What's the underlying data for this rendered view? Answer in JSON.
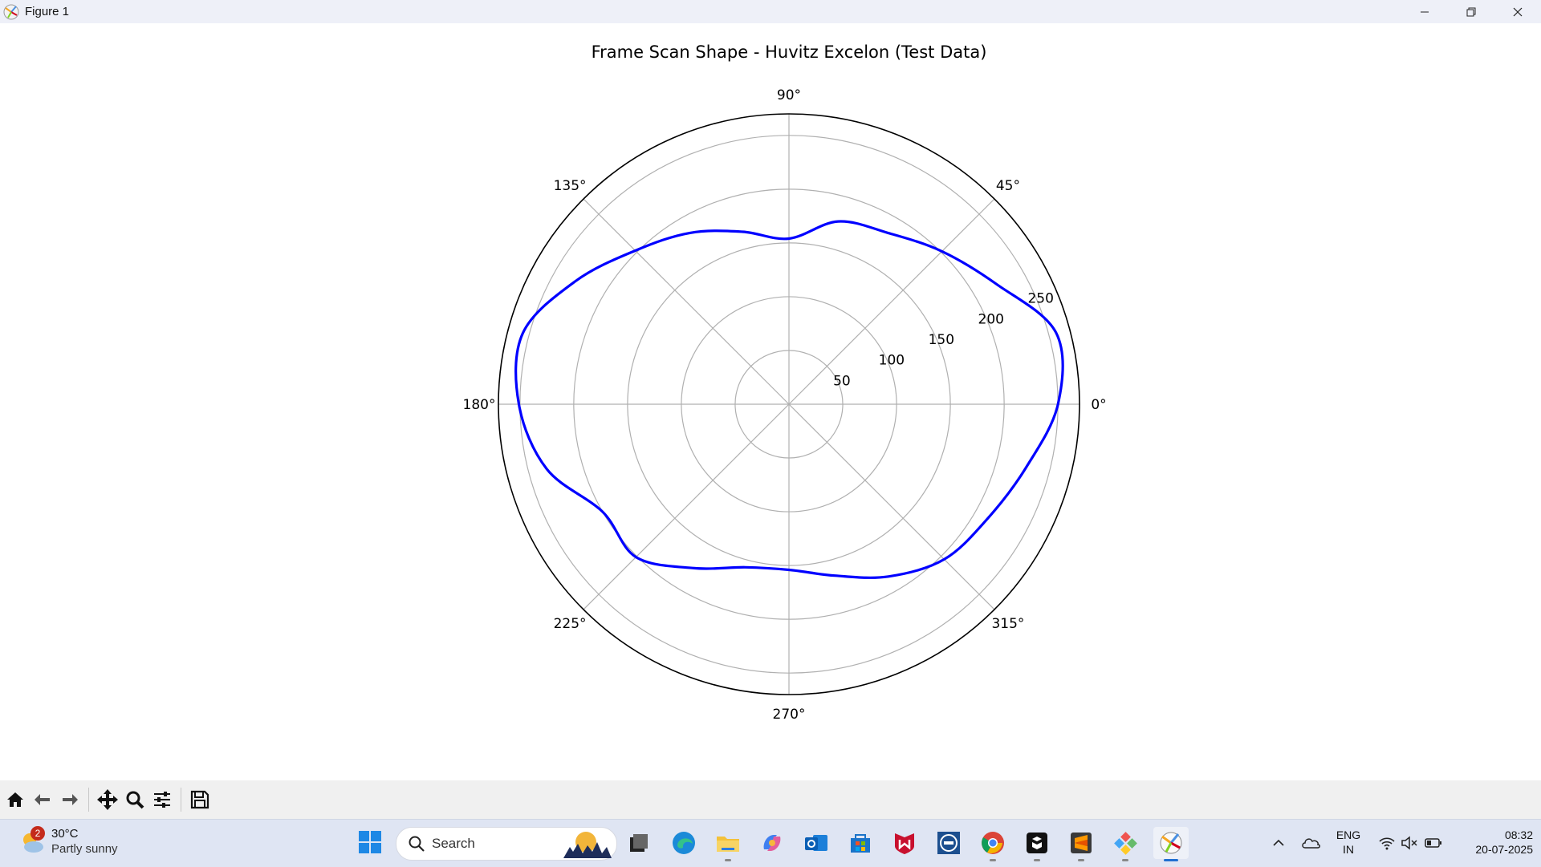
{
  "window": {
    "title": "Figure 1",
    "controls": [
      "minimize-icon",
      "restore-icon",
      "close-icon"
    ]
  },
  "chart_data": {
    "type": "polar-line",
    "title": "Frame Scan Shape - Huvitz Excelon (Test Data)",
    "theta_tick_labels": [
      "0°",
      "45°",
      "90°",
      "135°",
      "180°",
      "225°",
      "270°",
      "315°"
    ],
    "r_tick_labels": [
      "50",
      "100",
      "150",
      "200",
      "250"
    ],
    "r_ticks": [
      50,
      100,
      150,
      200,
      250
    ],
    "r_lim": [
      0,
      270
    ],
    "grid": true,
    "series": [
      {
        "color": "#0000ff",
        "theta_deg": [
          0,
          15,
          30,
          45,
          60,
          75,
          90,
          105,
          120,
          135,
          150,
          165,
          180,
          195,
          210,
          225,
          240,
          255,
          270,
          285,
          300,
          315,
          330,
          345
        ],
        "r": [
          250,
          257,
          223,
          201,
          184,
          176,
          154,
          166,
          184,
          202,
          229,
          256,
          251,
          233,
          200,
          201,
          176,
          157,
          154,
          165,
          185,
          204,
          213,
          228
        ]
      }
    ]
  },
  "toolbar": {
    "buttons": [
      "home-icon",
      "back-icon",
      "forward-icon",
      "pan-icon",
      "zoom-icon",
      "configure-subplots-icon",
      "save-icon"
    ]
  },
  "taskbar": {
    "weather": {
      "badge": "2",
      "temp": "30°C",
      "desc": "Partly sunny"
    },
    "search_placeholder": "Search",
    "apps": [
      "windows-start-icon",
      "task-view-icon",
      "edge-icon",
      "file-explorer-icon",
      "copilot-icon",
      "outlook-icon",
      "microsoft-store-icon",
      "mcafee-icon",
      "dell-icon",
      "chrome-icon",
      "app-black-icon",
      "sublime-text-icon",
      "vscode-like-icon",
      "matplotlib-figure-icon"
    ],
    "tray": {
      "lang_line1": "ENG",
      "lang_line2": "IN",
      "time": "08:32",
      "date": "20-07-2025"
    },
    "accent": "#1f6fd1"
  }
}
